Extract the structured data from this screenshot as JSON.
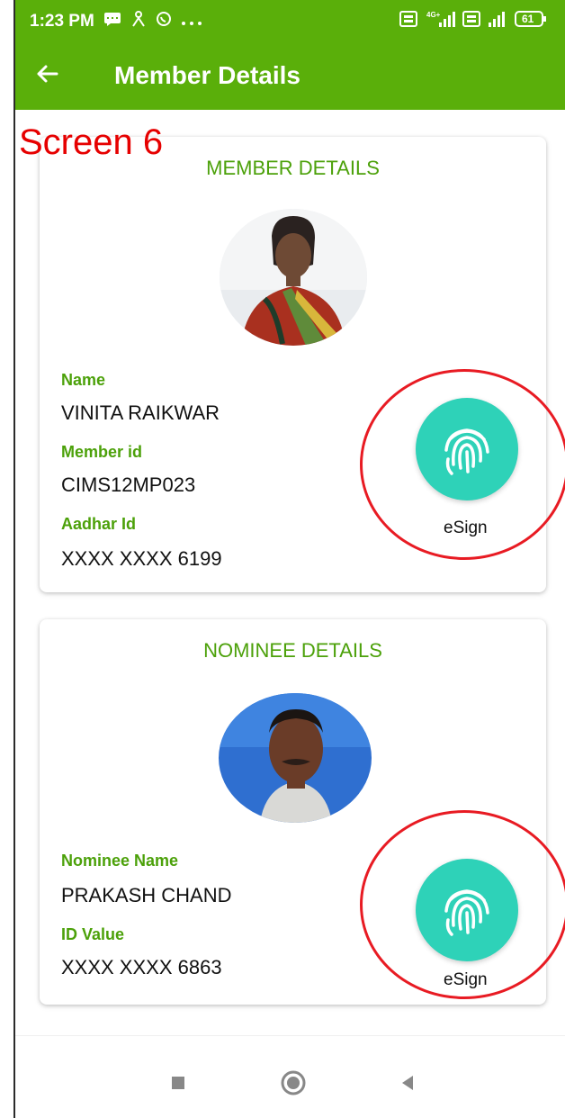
{
  "status_bar": {
    "time": "1:23 PM",
    "right_icons": [
      "volte-icon",
      "4g-signal-icon",
      "volte-icon",
      "signal-icon",
      "battery-icon"
    ],
    "battery": "61"
  },
  "app_bar": {
    "title": "Member Details"
  },
  "annotation": "Screen 6",
  "member_card": {
    "title": "MEMBER DETAILS",
    "fields": [
      {
        "label": "Name",
        "value": "VINITA RAIKWAR"
      },
      {
        "label": "Member id",
        "value": "CIMS12MP023"
      },
      {
        "label": "Aadhar Id",
        "value": "XXXX XXXX 6199"
      }
    ],
    "esign_label": "eSign"
  },
  "nominee_card": {
    "title": "NOMINEE DETAILS",
    "fields": [
      {
        "label": "Nominee Name",
        "value": "PRAKASH CHAND"
      },
      {
        "label": "ID Value",
        "value": "XXXX XXXX 6863"
      }
    ],
    "esign_label": "eSign"
  },
  "colors": {
    "app_bar": "#5aaf0a",
    "label_green": "#4ca10a",
    "fab_teal": "#2ed2b8",
    "annotation_red": "#e60000"
  }
}
